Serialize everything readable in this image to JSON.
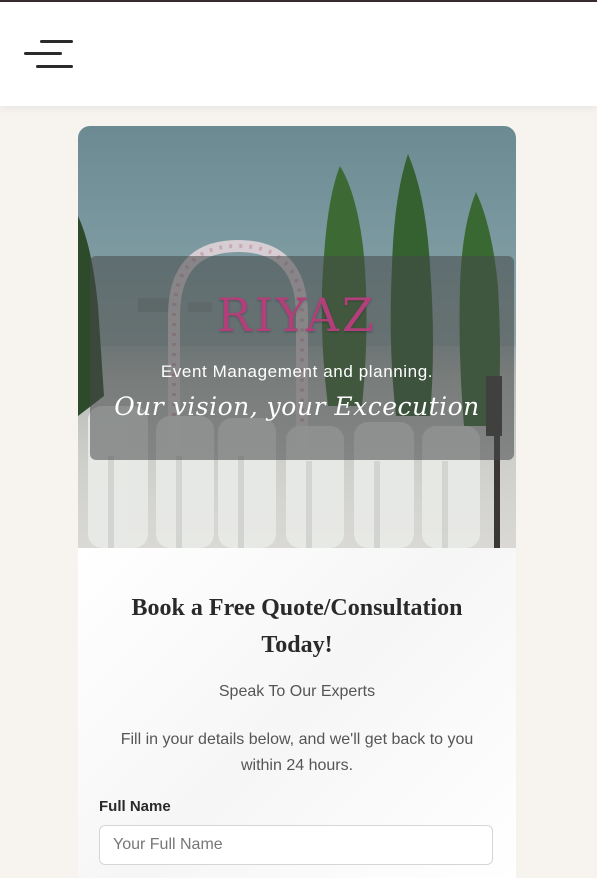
{
  "header": {
    "menu_icon": "hamburger-menu-icon"
  },
  "hero": {
    "brand": "RIYAZ",
    "subtitle": "Event Management and planning.",
    "tagline": "Our vision, your Excecution",
    "brand_color": "#b33f7a"
  },
  "form": {
    "title": "Book a Free Quote/Consultation Today!",
    "subtitle": "Speak To Our Experts",
    "description": "Fill in your details below, and we'll get back to you within 24 hours.",
    "full_name_label": "Full Name",
    "full_name_placeholder": "Your Full Name",
    "full_name_value": ""
  }
}
